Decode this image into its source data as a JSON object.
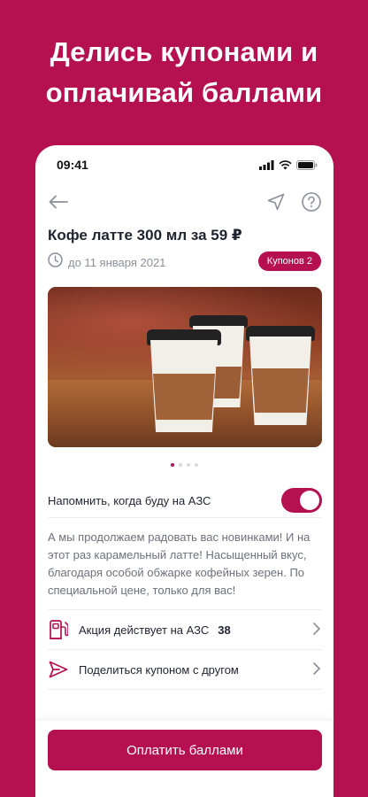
{
  "promo": {
    "line1": "Делись купонами и",
    "line2": "оплачивай баллами"
  },
  "status_bar": {
    "time": "09:41"
  },
  "offer": {
    "title": "Кофе латте 300 мл за 59 ₽",
    "valid_until": "до 11 января 2021",
    "coupons_badge": "Купонов 2"
  },
  "carousel": {
    "total": 4,
    "active_index": 0
  },
  "reminder": {
    "label": "Напомнить, когда буду на АЗС",
    "enabled": true
  },
  "description": "А мы продолжаем радовать вас новинками! И на этот раз карамельный латте! Насыщенный вкус, благодаря особой обжарке кофейных зерен. По специальной цене, только для вас!",
  "actions": [
    {
      "label": "Акция действует на АЗС",
      "count": "38",
      "icon": "fuel-station-icon"
    },
    {
      "label": "Поделиться купоном с другом",
      "count": "",
      "icon": "send-icon"
    }
  ],
  "pay_button": "Оплатить баллами",
  "colors": {
    "accent": "#b5104f",
    "text": "#1e2330",
    "muted": "#8a8f9a"
  }
}
